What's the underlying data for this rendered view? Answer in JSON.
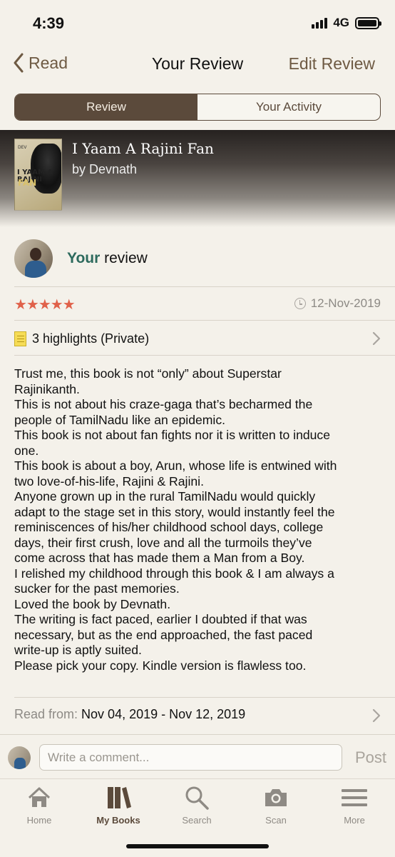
{
  "status_bar": {
    "time": "4:39",
    "network": "4G"
  },
  "nav": {
    "back_label": "Read",
    "title": "Your Review",
    "edit_label": "Edit Review"
  },
  "tabs_segment": [
    {
      "label": "Review",
      "active": true
    },
    {
      "label": "Your Activity",
      "active": false
    }
  ],
  "book": {
    "title": "I Yaam A Rajini Fan",
    "author": "by Devnath",
    "cover_text": {
      "top": "DEV",
      "middle": "I YAAM A\nRAJINI",
      "bottom": "FAN"
    }
  },
  "review": {
    "owner_prefix": "Your",
    "owner_suffix": " review",
    "stars": "★★★★★",
    "rating": 5,
    "date": "12-Nov-2019",
    "highlights": "3 highlights (Private)",
    "body": "Trust me, this book is not “only” about Superstar\nRajinikanth.\nThis is not about his craze-gaga that’s becharmed the\npeople of TamilNadu like an epidemic.\nThis book is not about fan fights nor it is written to induce\none.\nThis book is about a boy, Arun, whose life is entwined with\ntwo love-of-his-life, Rajini & Rajini.\nAnyone grown up in the rural TamilNadu would quickly\nadapt to the stage set in this story, would instantly feel the\nreminiscences of his/her childhood school days, college\ndays, their first crush, love and all the turmoils they’ve\ncome across that has made them a Man from a Boy.\nI relished my childhood through this book & I am always a\nsucker for the past memories.\nLoved the book by Devnath.\nThe writing is fact paced, earlier I doubted if that was\nnecessary, but as the end approached, the fast paced\nwrite-up is aptly suited.\nPlease pick your copy. Kindle version is flawless too.",
    "read_from_label": "Read from: ",
    "read_from_dates": "Nov 04, 2019 - Nov 12, 2019"
  },
  "comment": {
    "placeholder": "Write a comment...",
    "post_label": "Post"
  },
  "tabbar": [
    {
      "label": "Home",
      "icon": "home-icon",
      "active": false
    },
    {
      "label": "My Books",
      "icon": "books-icon",
      "active": true
    },
    {
      "label": "Search",
      "icon": "search-icon",
      "active": false
    },
    {
      "label": "Scan",
      "icon": "camera-icon",
      "active": false
    },
    {
      "label": "More",
      "icon": "menu-icon",
      "active": false
    }
  ],
  "colors": {
    "accent": "#6e5a43",
    "segment_active": "#5b4a3b",
    "stars": "#e0614a",
    "your_label": "#2d6a5d"
  }
}
